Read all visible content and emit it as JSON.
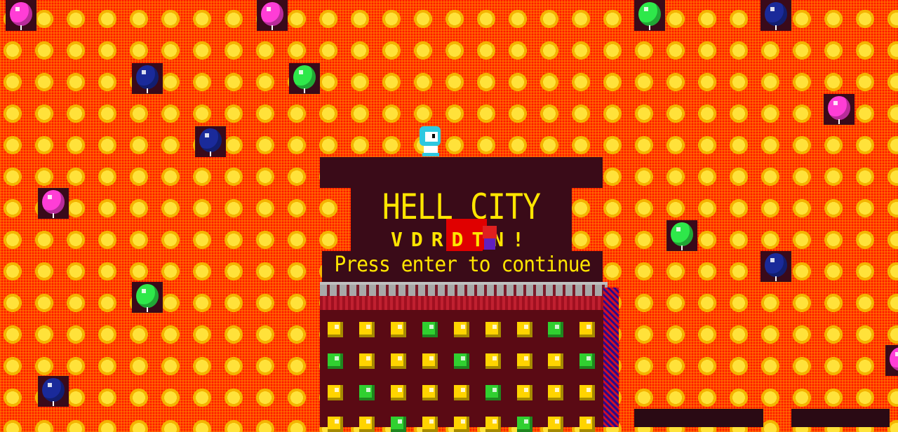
{
  "game": {
    "title": "HELL CITY",
    "subtitle": "VDRDTN!",
    "prompt": "Press enter to continue",
    "hud_left": "",
    "hud_right": ""
  },
  "colors": {
    "background_red": "#ff1800",
    "dot_yellow": "#ffe23a",
    "text_yellow": "#ffe600",
    "panel_dark": "#3a0b18"
  },
  "balloons": [
    {
      "color": "pink"
    },
    {
      "color": "pink"
    },
    {
      "color": "green"
    },
    {
      "color": "navy"
    },
    {
      "color": "navy"
    },
    {
      "color": "green"
    },
    {
      "color": "pink"
    },
    {
      "color": "navy"
    },
    {
      "color": "pink"
    },
    {
      "color": "green"
    },
    {
      "color": "navy"
    },
    {
      "color": "green"
    },
    {
      "color": "navy"
    },
    {
      "color": "pink"
    }
  ]
}
